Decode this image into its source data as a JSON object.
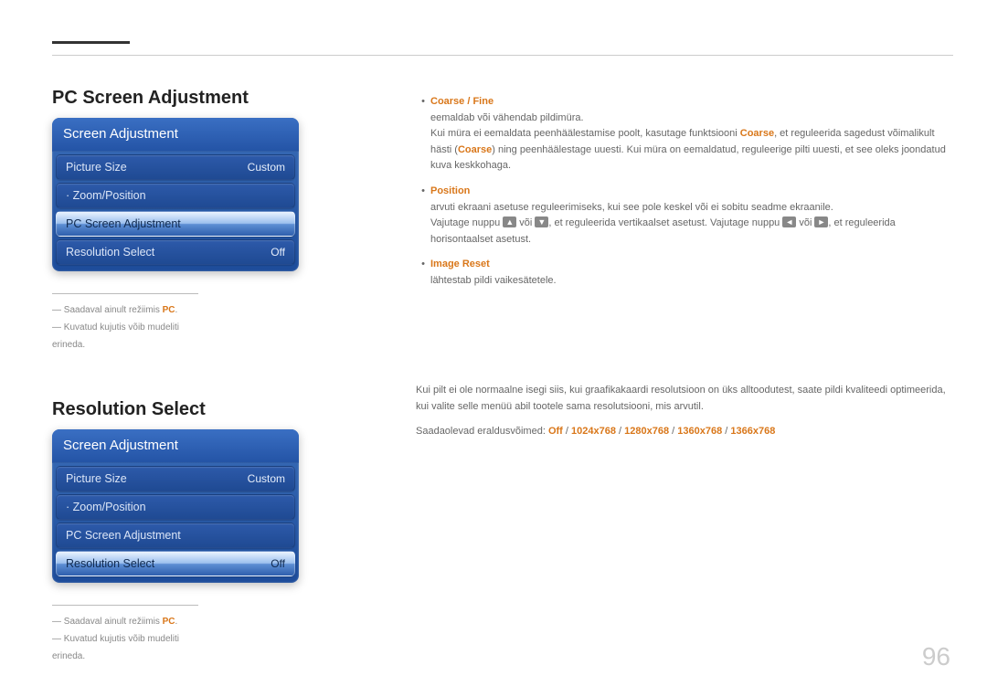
{
  "page_number": "96",
  "section1": {
    "title": "PC Screen Adjustment",
    "menu": {
      "title": "Screen Adjustment",
      "items": [
        {
          "label": "Picture Size",
          "value": "Custom"
        },
        {
          "label": "Zoom/Position",
          "value": "",
          "dot": true
        },
        {
          "label": "PC Screen Adjustment",
          "value": "",
          "selected": true
        },
        {
          "label": "Resolution Select",
          "value": "Off"
        }
      ]
    },
    "footnotes": [
      {
        "pre": "Saadaval ainult režiimis ",
        "orange": "PC",
        "post": "."
      },
      {
        "pre": "Kuvatud kujutis võib mudeliti erineda.",
        "orange": "",
        "post": ""
      }
    ],
    "right": {
      "b1_title": "Coarse / Fine",
      "b1_l1": "eemaldab või vähendab pildimüra.",
      "b1_l2a": "Kui müra ei eemaldata peenhäälestamise poolt, kasutage funktsiooni ",
      "b1_l2b": "Coarse",
      "b1_l2c": ", et reguleerida sagedust võimalikult hästi (",
      "b1_l2d": "Coarse",
      "b1_l2e": ") ning peenhäälestage uuesti. Kui müra on eemaldatud, reguleerige pilti uuesti, et see oleks joondatud kuva keskkohaga.",
      "b2_title": "Position",
      "b2_l1": "arvuti ekraani asetuse reguleerimiseks, kui see pole keskel või ei sobitu seadme ekraanile.",
      "b2_l2a": "Vajutage nuppu ",
      "b2_up": "▲",
      "b2_l2b": " või ",
      "b2_down": "▼",
      "b2_l2c": ", et reguleerida vertikaalset asetust. Vajutage nuppu ",
      "b2_left": "◄",
      "b2_l2d": " või ",
      "b2_right": "►",
      "b2_l2e": ", et reguleerida horisontaalset asetust.",
      "b3_title": "Image Reset",
      "b3_l1": "lähtestab pildi vaikesätetele."
    }
  },
  "section2": {
    "title": "Resolution Select",
    "menu": {
      "title": "Screen Adjustment",
      "items": [
        {
          "label": "Picture Size",
          "value": "Custom"
        },
        {
          "label": "Zoom/Position",
          "value": "",
          "dot": true
        },
        {
          "label": "PC Screen Adjustment",
          "value": ""
        },
        {
          "label": "Resolution Select",
          "value": "Off",
          "selected": true
        }
      ]
    },
    "footnotes": [
      {
        "pre": "Saadaval ainult režiimis ",
        "orange": "PC",
        "post": "."
      },
      {
        "pre": "Kuvatud kujutis võib mudeliti erineda.",
        "orange": "",
        "post": ""
      }
    ],
    "right": {
      "p1": "Kui pilt ei ole normaalne isegi siis, kui graafikakaardi resolutsioon on üks alltoodutest, saate pildi kvaliteedi optimeerida, kui valite selle menüü abil tootele sama resolutsiooni, mis arvutil.",
      "p2a": "Saadaolevad eraldusvõimed: ",
      "o1": "Off",
      "s": " / ",
      "o2": "1024x768",
      "o3": "1280x768",
      "o4": "1360x768",
      "o5": "1366x768"
    }
  }
}
